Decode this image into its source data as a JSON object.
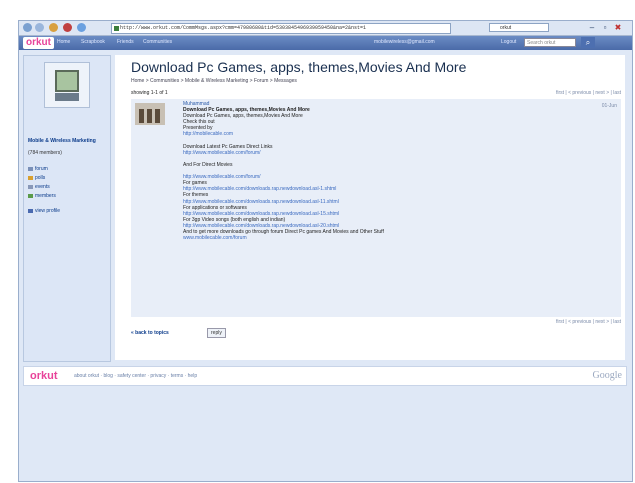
{
  "browser": {
    "url": "http://www.orkut.com/CommMsgs.aspx?cmm=47980680&tid=5303845496939059450&na=2&nst=1",
    "search_placeholder": "orkut",
    "win_min": "–",
    "win_max": "▫",
    "win_close": "✖"
  },
  "topbar": {
    "logo": "orkut",
    "nav": [
      "Home",
      "Scrapbook",
      "Friends",
      "Communities"
    ],
    "email": "mobilewireless@gmail.com",
    "logout": "Logout",
    "search_placeholder": "Search orkut",
    "search_icon": "search-icon"
  },
  "sidebar": {
    "community_name": "Mobile & Wireless Marketing",
    "members": "(784 members)",
    "items": [
      "forum",
      "polls",
      "events",
      "members"
    ],
    "profile": "view profile"
  },
  "main": {
    "title": "Download Pc Games, apps, themes,Movies And More",
    "breadcrumb": "Home > Communities > Mobile & Wireless Marketing > Forum > Messages",
    "showing": "showing 1-1 of 1",
    "pager": "first  |  < previous  |  next >  |  last",
    "back": "« back to topics",
    "reply": "reply"
  },
  "post": {
    "author": "Muhammad",
    "date": "01-Jun",
    "lines": [
      {
        "t": "Download Pc Games, apps, themes,Movies And More",
        "s": "bold"
      },
      {
        "t": "Download Pc Games, apps, themes,Movies And More",
        "s": ""
      },
      {
        "t": "Check this out",
        "s": ""
      },
      {
        "t": "Presented by",
        "s": ""
      },
      {
        "t": "http://mobilecable.com",
        "s": "lnk"
      },
      {
        "t": "",
        "s": ""
      },
      {
        "t": "Download Latest Pc Games Direct Links",
        "s": ""
      },
      {
        "t": "http://www.mobilecable.com/forum/",
        "s": "lnk"
      },
      {
        "t": "",
        "s": ""
      },
      {
        "t": "And For Direct Movies",
        "s": ""
      },
      {
        "t": "",
        "s": ""
      },
      {
        "t": "http://www.mobilecable.com/forum/",
        "s": "lnk"
      },
      {
        "t": "For games",
        "s": ""
      },
      {
        "t": "http://www.mobilecable.com/downloads.rap.newdownload.asl-1.shtml",
        "s": "lnk"
      },
      {
        "t": "For themes",
        "s": ""
      },
      {
        "t": "http://www.mobilecable.com/downloads.rap.newdownload.asl-11.shtml",
        "s": "lnk"
      },
      {
        "t": "For applications or softwares",
        "s": ""
      },
      {
        "t": "http://www.mobilecable.com/downloads.rap.newdownload.asl-15.shtml",
        "s": "lnk"
      },
      {
        "t": "For 3gp Video songs (both english and indian)",
        "s": ""
      },
      {
        "t": "http://www.mobilecable.com/downloads.rap.newdownload.asl-20.shtml",
        "s": "lnk"
      },
      {
        "t": "And to get more downloads go through forum Direct Pc games And Movies and Other Stuff",
        "s": ""
      },
      {
        "t": "www.mobilecable.com/forum",
        "s": "lnk"
      }
    ]
  },
  "footer": {
    "logo": "orkut",
    "links": "about orkut  ·  blog  ·  safety center  ·  privacy  ·  terms  ·  help",
    "google": "Google"
  },
  "colors": {
    "brand_pink": "#e8439a",
    "bar_blue": "#5a7ab8",
    "link_blue": "#3a6ac0"
  }
}
